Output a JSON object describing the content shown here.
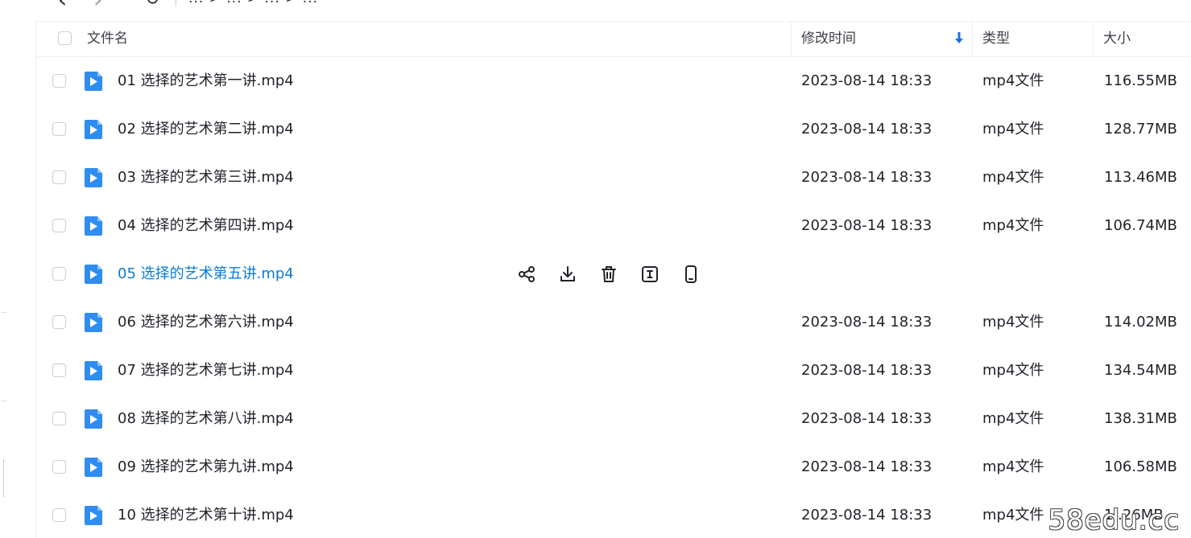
{
  "breadcrumb": {
    "text": "... > ... > ... > ..."
  },
  "table": {
    "headers": {
      "name": "文件名",
      "modified": "修改时间",
      "type": "类型",
      "size": "大小"
    },
    "rows": [
      {
        "name": "01 选择的艺术第一讲.mp4",
        "modified": "2023-08-14 18:33",
        "type": "mp4文件",
        "size": "116.55MB"
      },
      {
        "name": "02 选择的艺术第二讲.mp4",
        "modified": "2023-08-14 18:33",
        "type": "mp4文件",
        "size": "128.77MB"
      },
      {
        "name": "03 选择的艺术第三讲.mp4",
        "modified": "2023-08-14 18:33",
        "type": "mp4文件",
        "size": "113.46MB"
      },
      {
        "name": "04 选择的艺术第四讲.mp4",
        "modified": "2023-08-14 18:33",
        "type": "mp4文件",
        "size": "106.74MB"
      },
      {
        "name": "05 选择的艺术第五讲.mp4",
        "modified": "",
        "type": "",
        "size": ""
      },
      {
        "name": "06 选择的艺术第六讲.mp4",
        "modified": "2023-08-14 18:33",
        "type": "mp4文件",
        "size": "114.02MB"
      },
      {
        "name": "07 选择的艺术第七讲.mp4",
        "modified": "2023-08-14 18:33",
        "type": "mp4文件",
        "size": "134.54MB"
      },
      {
        "name": "08 选择的艺术第八讲.mp4",
        "modified": "2023-08-14 18:33",
        "type": "mp4文件",
        "size": "138.31MB"
      },
      {
        "name": "09 选择的艺术第九讲.mp4",
        "modified": "2023-08-14 18:33",
        "type": "mp4文件",
        "size": "106.58MB"
      },
      {
        "name": "10 选择的艺术第十讲.mp4",
        "modified": "2023-08-14 18:33",
        "type": "mp4文件",
        "size": "1..26MB"
      }
    ],
    "hover_row_index": 4,
    "hover_actions": [
      "share-icon",
      "download-icon",
      "trash-icon",
      "rename-icon",
      "phone-icon"
    ]
  },
  "watermark": "58edu.cc",
  "colors": {
    "accent": "#0a7cd6",
    "file_icon": "#2f8cf0",
    "divider": "#eef0f3"
  }
}
